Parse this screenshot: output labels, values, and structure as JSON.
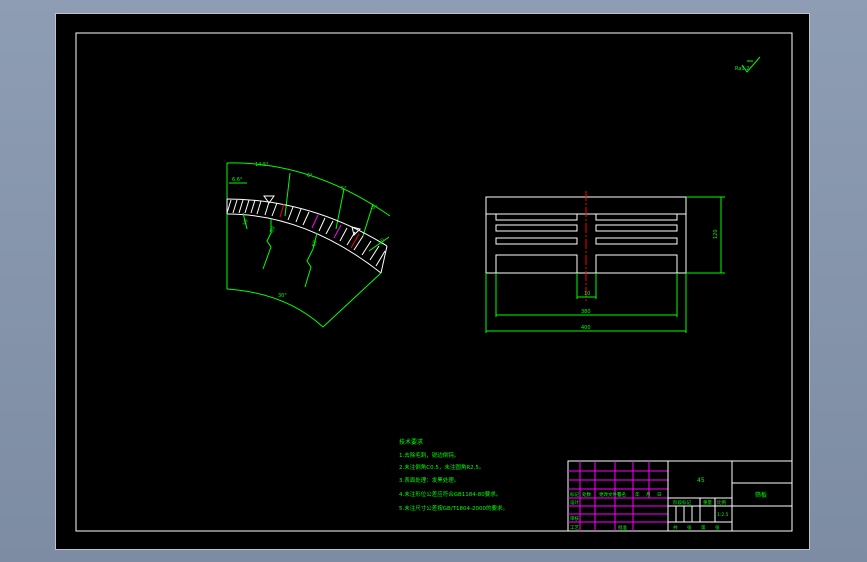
{
  "colors": {
    "outline": "#ffffff",
    "dimension": "#00ff00",
    "title_grid": "#ff00ff",
    "centerline": "#ff0000",
    "background": "#000000"
  },
  "roughness": {
    "value": "Ra3.2"
  },
  "sector_view": {
    "arc_labels": [
      "14.5°",
      "6°",
      "5°",
      "5°"
    ],
    "small_angle": "6.6°",
    "dims": [
      "60",
      "60",
      "10",
      "10"
    ],
    "bottom_arc_label": "30°"
  },
  "front_view": {
    "height_dim": "120",
    "slot_dim": "10",
    "inner_width_dim": "380",
    "overall_width_dim": "400"
  },
  "notes": {
    "heading": "技术要求",
    "items": [
      "1.去除毛刺，锐边倒钝。",
      "2.未注倒角C0.5，未注圆角R2.5。",
      "3.表面处理：发黑处理。",
      "4.未注形位公差应符合GB1184-80要求。",
      "5.未注尺寸公差按GB/T1804-2000的要求。"
    ]
  },
  "title_block": {
    "material": "45",
    "drawing_name": "筛板",
    "headers": [
      "标记",
      "处数",
      "更改文件号",
      "签名",
      "年",
      "月",
      "日"
    ],
    "rows": [
      "设计",
      "审核",
      "工艺",
      "批准"
    ],
    "stage_labels": [
      "阶段标记",
      "重量",
      "比例"
    ],
    "scale": "1:2.5",
    "sheet_labels": [
      "共",
      "张",
      "第",
      "张"
    ]
  }
}
